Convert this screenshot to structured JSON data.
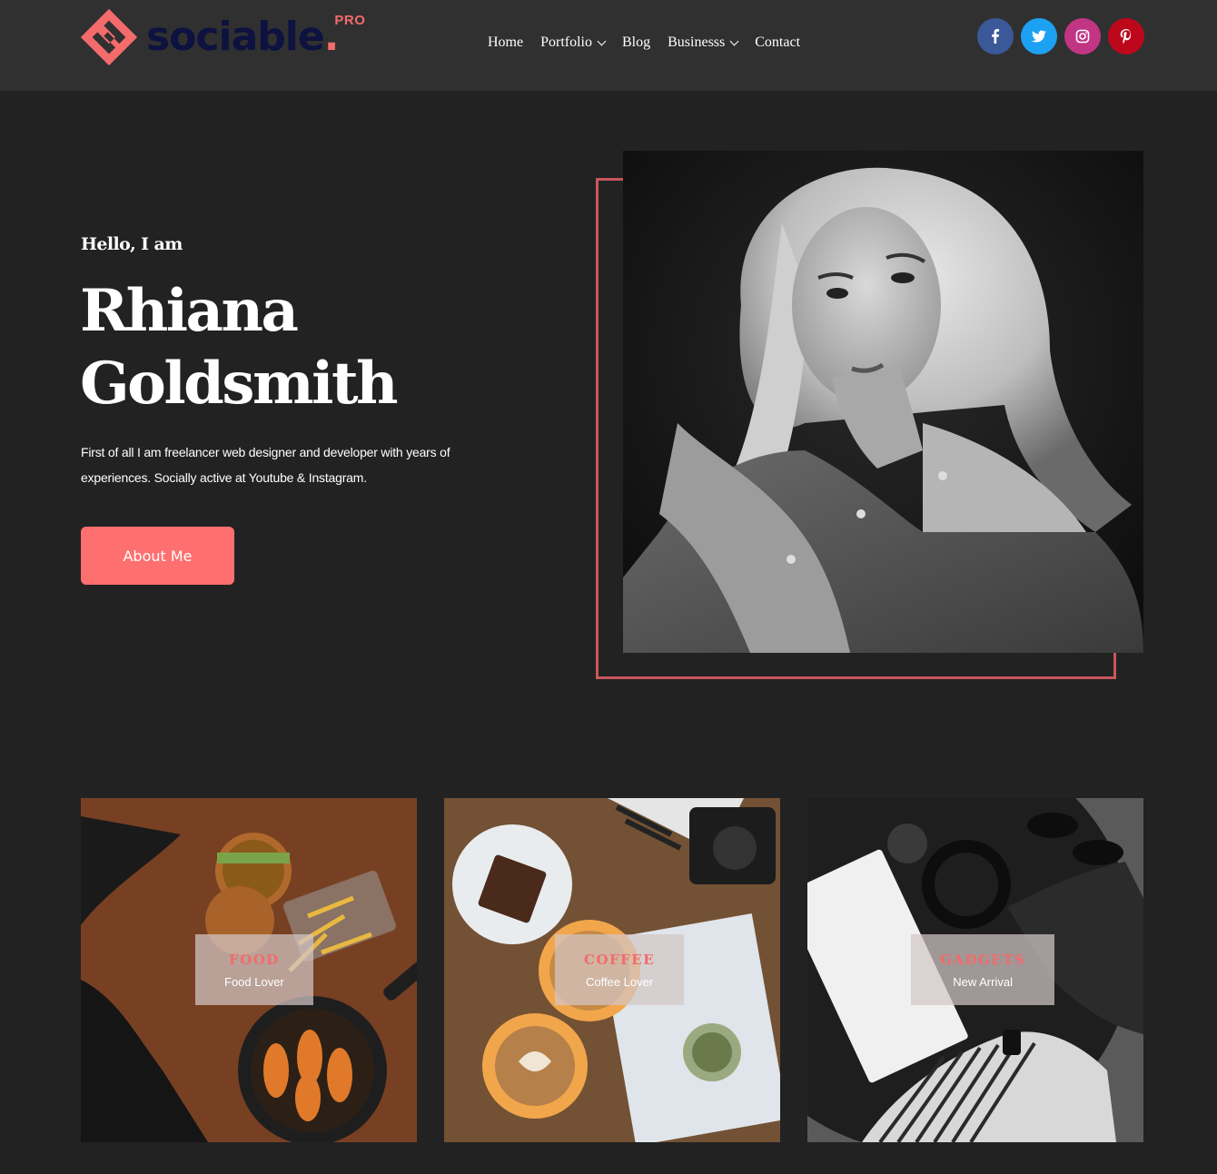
{
  "brand": {
    "name": "sociable",
    "dot": ".",
    "badge": "PRO",
    "accent_color": "#f36b6b",
    "text_color": "#0d1240"
  },
  "nav": {
    "items": [
      {
        "label": "Home",
        "has_dropdown": false
      },
      {
        "label": "Portfolio",
        "has_dropdown": true
      },
      {
        "label": "Blog",
        "has_dropdown": false
      },
      {
        "label": "Businesss",
        "has_dropdown": true
      },
      {
        "label": "Contact",
        "has_dropdown": false
      }
    ]
  },
  "socials": [
    {
      "network": "facebook",
      "icon": "facebook-icon",
      "color": "#3b5998"
    },
    {
      "network": "twitter",
      "icon": "twitter-icon",
      "color": "#1da1f2"
    },
    {
      "network": "instagram",
      "icon": "instagram-icon",
      "color": "#c13584"
    },
    {
      "network": "pinterest",
      "icon": "pinterest-icon",
      "color": "#bd081c"
    }
  ],
  "hero": {
    "greeting": "Hello, I am",
    "name_line1": "Rhiana",
    "name_line2": "Goldsmith",
    "intro": "First of all I am freelancer web designer and developer with years of experiences. Socially active at Youtube & Instagram.",
    "cta_label": "About Me",
    "cta_color": "#fe6f6f",
    "frame_color": "#c9565c"
  },
  "cards": [
    {
      "title": "FOOD",
      "subtitle": "Food Lover"
    },
    {
      "title": "COFFEE",
      "subtitle": "Coffee Lover"
    },
    {
      "title": "GADGETS",
      "subtitle": "New Arrival"
    }
  ],
  "colors": {
    "page_bg": "#222223",
    "header_bg": "#303031"
  }
}
